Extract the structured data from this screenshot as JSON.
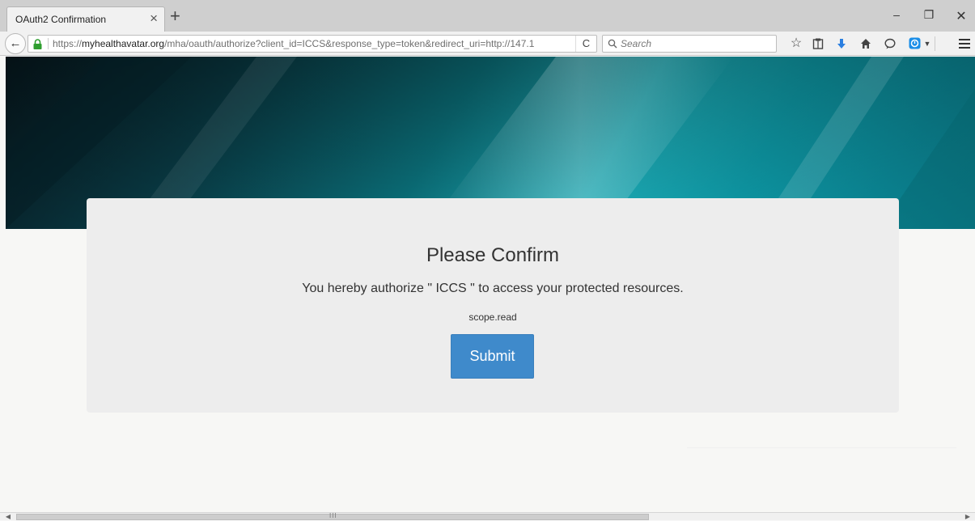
{
  "browser": {
    "tab_title": "OAuth2 Confirmation",
    "tab_close": "×",
    "new_tab": "+",
    "window_controls": {
      "minimize": "–",
      "maximize": "❐",
      "close": "✕"
    },
    "url_prefix": "https://",
    "url_host": "myhealthavatar.org",
    "url_path": "/mha/oauth/authorize?client_id=ICCS&response_type=token&redirect_uri=http://147.1",
    "reload": "C",
    "search_placeholder": "Search",
    "toolbar_icons": [
      "star-icon",
      "reading-list-icon",
      "download-icon",
      "home-icon",
      "chat-icon",
      "pocket-icon",
      "menu-icon"
    ]
  },
  "confirm": {
    "title": "Please Confirm",
    "message": "You hereby authorize \" ICCS \" to access your protected resources.",
    "scope": "scope.read",
    "submit_label": "Submit"
  },
  "scrollbar": {
    "grip": "III"
  },
  "colors": {
    "hero_accent": "#23c6d2",
    "button": "#3f8acb",
    "card": "#ededed"
  }
}
